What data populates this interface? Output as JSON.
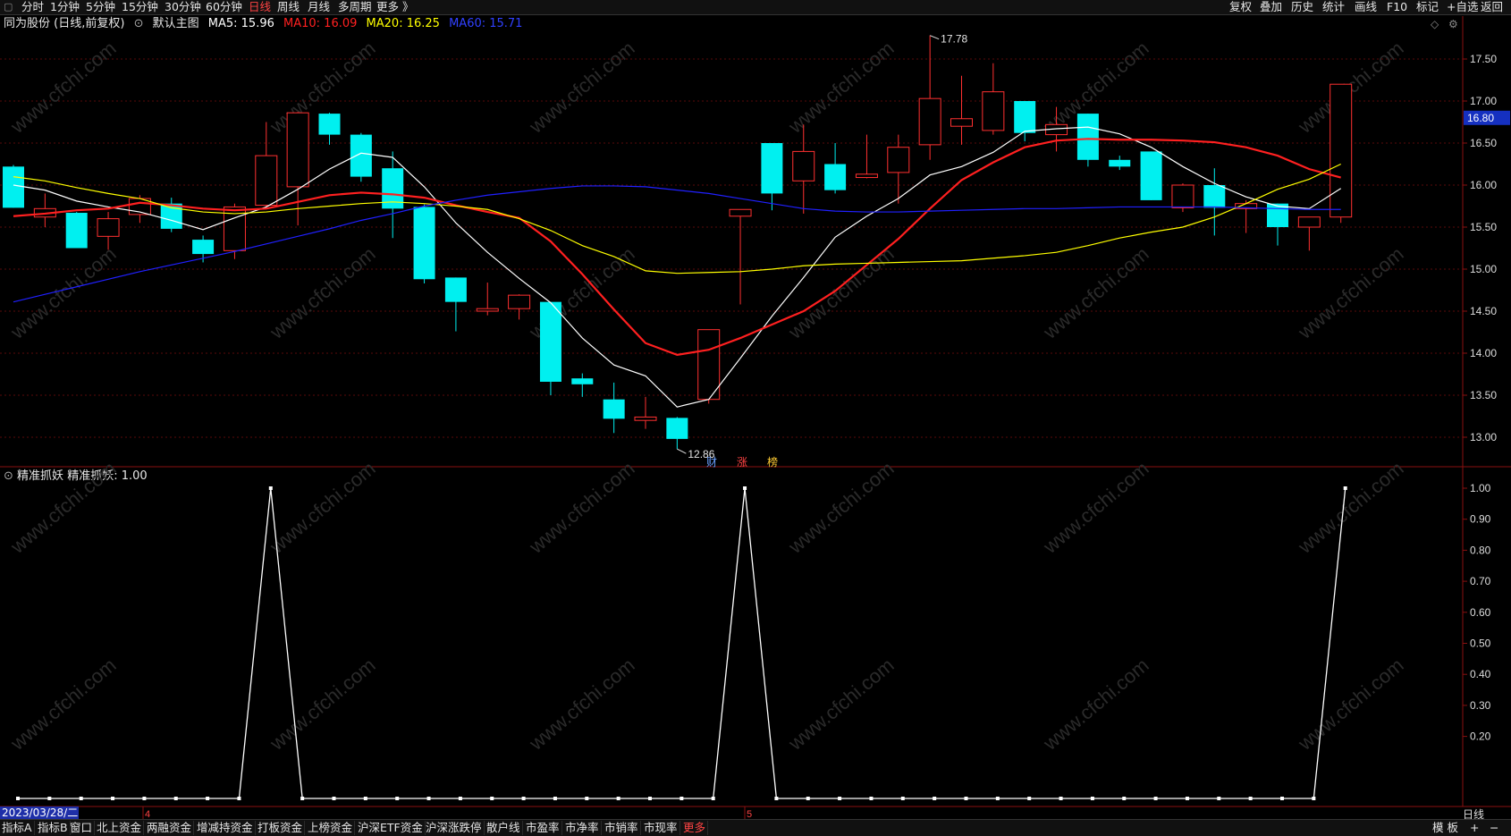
{
  "toolbar": {
    "menu_icon": "▢",
    "periods": [
      "分时",
      "1分钟",
      "5分钟",
      "15分钟",
      "30分钟",
      "60分钟",
      "日线",
      "周线",
      "月线",
      "多周期",
      "更多 》"
    ],
    "active_period": "日线",
    "right_items": [
      "复权",
      "叠加",
      "历史",
      "统计",
      "画线",
      "F10",
      "标记",
      "+自选",
      "返回"
    ]
  },
  "chart_header": {
    "stock": "同为股份 (日线,前复权)",
    "template": "默认主图",
    "ma5": "MA5: 15.96",
    "ma10": "MA10: 16.09",
    "ma20": "MA20: 16.25",
    "ma60": "MA60: 15.71"
  },
  "indicator_header": {
    "name": "精准抓妖",
    "value": "精准抓妖: 1.00"
  },
  "price_axis": [
    "17.50",
    "17.00",
    "16.50",
    "16.00",
    "15.50",
    "15.00",
    "14.50",
    "14.00",
    "13.50",
    "13.00"
  ],
  "price_marker": "16.80",
  "high_label": "17.78",
  "low_label": "12.86",
  "event_tags": [
    "财",
    "涨",
    "榜"
  ],
  "indicator_axis": [
    "1.00",
    "0.90",
    "0.80",
    "0.70",
    "0.60",
    "0.50",
    "0.40",
    "0.30",
    "0.20"
  ],
  "date_label": "2023/03/28/二",
  "month_marks": [
    "4",
    "5"
  ],
  "period_label": "日线",
  "bottom_tabs": [
    "指标A",
    "指标B",
    "窗口",
    "北上资金",
    "两融资金",
    "增减持资金",
    "打板资金",
    "上榜资金",
    "沪深ETF资金",
    "沪深涨跌停",
    "散户线",
    "市盈率",
    "市净率",
    "市销率",
    "市现率",
    "更多"
  ],
  "bottom_right": [
    "模 板",
    "+",
    "−"
  ],
  "watermark": "www.cfchi.com",
  "colors": {
    "up": "#ff3030",
    "down": "#00f0f0",
    "ma5": "#ffffff",
    "ma10": "#ff2020",
    "ma20": "#ffff00",
    "ma60": "#2020ff"
  },
  "chart_data": {
    "type": "candlestick",
    "series": "同为股份 日线",
    "ylim": [
      12.7,
      17.9
    ],
    "candles": [
      {
        "o": 16.22,
        "h": 16.24,
        "l": 15.73,
        "c": 15.73
      },
      {
        "o": 15.62,
        "h": 15.9,
        "l": 15.5,
        "c": 15.72
      },
      {
        "o": 15.67,
        "h": 15.68,
        "l": 15.25,
        "c": 15.25
      },
      {
        "o": 15.39,
        "h": 15.68,
        "l": 15.23,
        "c": 15.6
      },
      {
        "o": 15.65,
        "h": 15.88,
        "l": 15.55,
        "c": 15.84
      },
      {
        "o": 15.78,
        "h": 15.85,
        "l": 15.44,
        "c": 15.48
      },
      {
        "o": 15.35,
        "h": 15.4,
        "l": 15.08,
        "c": 15.18
      },
      {
        "o": 15.22,
        "h": 15.78,
        "l": 15.12,
        "c": 15.74
      },
      {
        "o": 15.76,
        "h": 16.75,
        "l": 15.72,
        "c": 16.35
      },
      {
        "o": 15.98,
        "h": 16.87,
        "l": 15.52,
        "c": 16.86
      },
      {
        "o": 16.85,
        "h": 16.86,
        "l": 16.48,
        "c": 16.6
      },
      {
        "o": 16.6,
        "h": 16.62,
        "l": 16.04,
        "c": 16.1
      },
      {
        "o": 16.2,
        "h": 16.4,
        "l": 15.37,
        "c": 15.72
      },
      {
        "o": 15.74,
        "h": 15.77,
        "l": 14.83,
        "c": 14.88
      },
      {
        "o": 14.9,
        "h": 14.9,
        "l": 14.26,
        "c": 14.61
      },
      {
        "o": 14.5,
        "h": 14.84,
        "l": 14.45,
        "c": 14.53
      },
      {
        "o": 14.53,
        "h": 14.7,
        "l": 14.4,
        "c": 14.69
      },
      {
        "o": 14.61,
        "h": 14.61,
        "l": 13.5,
        "c": 13.66
      },
      {
        "o": 13.7,
        "h": 13.76,
        "l": 13.48,
        "c": 13.63
      },
      {
        "o": 13.45,
        "h": 13.65,
        "l": 13.05,
        "c": 13.22
      },
      {
        "o": 13.2,
        "h": 13.48,
        "l": 13.1,
        "c": 13.24
      },
      {
        "o": 13.23,
        "h": 13.24,
        "l": 12.86,
        "c": 12.98
      },
      {
        "o": 13.45,
        "h": 14.28,
        "l": 13.4,
        "c": 14.28
      },
      {
        "o": 15.63,
        "h": 15.71,
        "l": 14.58,
        "c": 15.71
      },
      {
        "o": 16.5,
        "h": 16.5,
        "l": 15.7,
        "c": 15.9
      },
      {
        "o": 16.05,
        "h": 16.72,
        "l": 15.66,
        "c": 16.4
      },
      {
        "o": 16.25,
        "h": 16.5,
        "l": 15.9,
        "c": 15.94
      },
      {
        "o": 16.09,
        "h": 16.6,
        "l": 16.08,
        "c": 16.13
      },
      {
        "o": 16.15,
        "h": 16.6,
        "l": 15.78,
        "c": 16.45
      },
      {
        "o": 16.48,
        "h": 17.78,
        "l": 16.3,
        "c": 17.03
      },
      {
        "o": 16.7,
        "h": 17.3,
        "l": 16.48,
        "c": 16.79
      },
      {
        "o": 16.65,
        "h": 17.45,
        "l": 16.6,
        "c": 17.11
      },
      {
        "o": 17.0,
        "h": 17.0,
        "l": 16.52,
        "c": 16.62
      },
      {
        "o": 16.6,
        "h": 16.93,
        "l": 16.4,
        "c": 16.72
      },
      {
        "o": 16.85,
        "h": 16.85,
        "l": 16.22,
        "c": 16.3
      },
      {
        "o": 16.3,
        "h": 16.35,
        "l": 16.18,
        "c": 16.22
      },
      {
        "o": 16.4,
        "h": 16.4,
        "l": 15.82,
        "c": 15.82
      },
      {
        "o": 15.73,
        "h": 16.02,
        "l": 15.68,
        "c": 16.0
      },
      {
        "o": 16.0,
        "h": 16.2,
        "l": 15.4,
        "c": 15.73
      },
      {
        "o": 15.72,
        "h": 15.82,
        "l": 15.43,
        "c": 15.78
      },
      {
        "o": 15.78,
        "h": 15.78,
        "l": 15.28,
        "c": 15.5
      },
      {
        "o": 15.5,
        "h": 15.6,
        "l": 15.22,
        "c": 15.62
      },
      {
        "o": 15.62,
        "h": 17.2,
        "l": 15.55,
        "c": 17.2
      }
    ],
    "ma": [
      {
        "name": "MA5",
        "color": "#ffffff",
        "values": [
          16.0,
          15.94,
          15.81,
          15.74,
          15.68,
          15.58,
          15.47,
          15.61,
          15.74,
          15.95,
          16.19,
          16.38,
          16.33,
          15.98,
          15.55,
          15.2,
          14.89,
          14.6,
          14.18,
          13.86,
          13.73,
          13.36,
          13.45,
          13.94,
          14.44,
          14.9,
          15.38,
          15.63,
          15.84,
          16.12,
          16.22,
          16.39,
          16.64,
          16.67,
          16.69,
          16.61,
          16.45,
          16.22,
          16.02,
          15.86,
          15.75,
          15.72,
          15.96
        ]
      },
      {
        "name": "MA10",
        "color": "#ff2020",
        "values": [
          15.63,
          15.66,
          15.7,
          15.72,
          15.79,
          15.76,
          15.72,
          15.7,
          15.72,
          15.8,
          15.88,
          15.91,
          15.89,
          15.85,
          15.76,
          15.68,
          15.61,
          15.33,
          14.94,
          14.52,
          14.12,
          13.98,
          14.04,
          14.18,
          14.34,
          14.5,
          14.74,
          15.05,
          15.36,
          15.72,
          16.06,
          16.27,
          16.45,
          16.53,
          16.55,
          16.54,
          16.54,
          16.53,
          16.51,
          16.45,
          16.35,
          16.19,
          16.09
        ]
      },
      {
        "name": "MA20",
        "color": "#ffff00",
        "values": [
          16.1,
          16.05,
          15.97,
          15.9,
          15.84,
          15.73,
          15.68,
          15.66,
          15.68,
          15.72,
          15.75,
          15.78,
          15.8,
          15.78,
          15.75,
          15.71,
          15.6,
          15.46,
          15.28,
          15.15,
          14.98,
          14.95,
          14.96,
          14.97,
          15.0,
          15.04,
          15.06,
          15.07,
          15.08,
          15.09,
          15.1,
          15.13,
          15.16,
          15.2,
          15.28,
          15.37,
          15.44,
          15.5,
          15.62,
          15.78,
          15.95,
          16.07,
          16.25
        ]
      },
      {
        "name": "MA60",
        "color": "#2020ff",
        "values": [
          14.61,
          14.7,
          14.79,
          14.88,
          14.97,
          15.05,
          15.13,
          15.21,
          15.3,
          15.39,
          15.48,
          15.58,
          15.66,
          15.75,
          15.82,
          15.88,
          15.92,
          15.96,
          15.99,
          15.99,
          15.98,
          15.94,
          15.9,
          15.84,
          15.78,
          15.72,
          15.69,
          15.68,
          15.68,
          15.69,
          15.7,
          15.71,
          15.72,
          15.72,
          15.73,
          15.74,
          15.74,
          15.74,
          15.74,
          15.73,
          15.72,
          15.71,
          15.71
        ]
      }
    ],
    "indicator": {
      "name": "精准抓妖",
      "ylim": [
        0,
        1
      ],
      "values": [
        0,
        0,
        0,
        0,
        0,
        0,
        0,
        0,
        1,
        0,
        0,
        0,
        0,
        0,
        0,
        0,
        0,
        0,
        0,
        0,
        0,
        0,
        0,
        1,
        0,
        0,
        0,
        0,
        0,
        0,
        0,
        0,
        0,
        0,
        0,
        0,
        0,
        0,
        0,
        0,
        0,
        0,
        1
      ]
    }
  }
}
